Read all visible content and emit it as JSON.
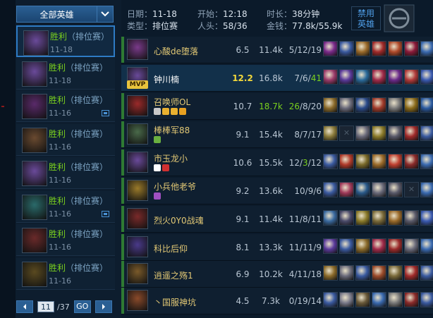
{
  "filter": {
    "label": "全部英雄"
  },
  "games": [
    {
      "result": "胜利",
      "queue": "（排位赛）",
      "date": "11-18",
      "color": "#6a4a9a",
      "flag": false
    },
    {
      "result": "胜利",
      "queue": "（排位赛）",
      "date": "11-18",
      "color": "#6a4a9a",
      "flag": false
    },
    {
      "result": "胜利",
      "queue": "（排位赛）",
      "date": "11-16",
      "color": "#5a2a6a",
      "flag": true
    },
    {
      "result": "胜利",
      "queue": "（排位赛）",
      "date": "11-16",
      "color": "#6a4a30",
      "flag": false
    },
    {
      "result": "胜利",
      "queue": "（排位赛）",
      "date": "11-16",
      "color": "#6a4a9a",
      "flag": false
    },
    {
      "result": "胜利",
      "queue": "（排位赛）",
      "date": "11-16",
      "color": "#2a6a6a",
      "flag": true
    },
    {
      "result": "胜利",
      "queue": "（排位赛）",
      "date": "11-16",
      "color": "#6a2a2a",
      "flag": false
    },
    {
      "result": "胜利",
      "queue": "（排位赛）",
      "date": "11-16",
      "color": "#5a4a20",
      "flag": false
    }
  ],
  "pager": {
    "page": "11",
    "total": "/37",
    "go": "GO"
  },
  "info": {
    "date_k": "日期：",
    "date_v": "11-18",
    "type_k": "类型：",
    "type_v": "排位赛",
    "start_k": "开始：",
    "start_v": "12:18",
    "people_k": "人头：",
    "people_v": "58/36",
    "dur_k": "时长：",
    "dur_v": "38分钟",
    "money_k": "金钱：",
    "money_v": "77.8k/55.9k",
    "ban_l1": "禁用",
    "ban_l2": "英雄"
  },
  "mvp": "MVP",
  "players": [
    {
      "name": "心酸de堕落",
      "kda_ratio": "6.5",
      "gold": "11.4k",
      "stats": "5/12/19",
      "green": "",
      "sel": false,
      "color": "#7a3a8a",
      "items": [
        "#7a2a8a",
        "#3a5aa0",
        "#9a6a2a",
        "#a02a2a",
        "#b04a2a",
        "#8a1a3a",
        "#3a6ab0"
      ]
    },
    {
      "name": "钟川楠",
      "kda_ratio": "12.2",
      "gold": "16.8k",
      "stats_pre": "7/6/",
      "stats_g": "41",
      "sel": true,
      "color": "#6a4a9a",
      "items": [
        "#9a3a6a",
        "#5a3a9a",
        "#2a6a9a",
        "#a02a4a",
        "#6a2a8a",
        "#b03a3a",
        "#3a5ab0"
      ]
    },
    {
      "name": "召唤师OL",
      "kda_ratio": "10.7",
      "gold": "18.7k",
      "gold_hi": true,
      "stats_pre_g": "26",
      "stats_post": "/8/20",
      "sel": false,
      "color": "#9a2a2a",
      "items": [
        "#8a6a2a",
        "#6a6a7a",
        "#2a4a8a",
        "#a03a2a",
        "#7a7a7a",
        "#8a6a1a",
        "#2a5aa0"
      ],
      "badges": [
        "#c8c8c8",
        "#e8b030",
        "#e8b030",
        "#e8a020"
      ]
    },
    {
      "name": "棒棒军88",
      "kda_ratio": "9.1",
      "gold": "15.4k",
      "stats": "8/7/17",
      "sel": false,
      "color": "#4a6a4a",
      "items": [
        "#8a7a3a",
        "empty",
        "#6a6a7a",
        "#8a7a2a",
        "#5a5a6a",
        "#a02a2a",
        "#3a5aa0"
      ],
      "badges": [
        "#6ab040"
      ]
    },
    {
      "name": "市玉龙小",
      "kda_ratio": "10.6",
      "gold": "15.5k",
      "stats_pre": "12/",
      "stats_g": "3",
      "stats_post": "/12",
      "sel": false,
      "color": "#6a4a9a",
      "items": [
        "#3a5aa0",
        "#b03a2a",
        "#7a6a2a",
        "#9a6a2a",
        "#c04030",
        "#8a2a2a",
        "#3a6ab0"
      ],
      "badges": [
        "#ffffff",
        "#d03030"
      ]
    },
    {
      "name": "小兵他老爷",
      "kda_ratio": "9.2",
      "gold": "13.6k",
      "stats": "10/9/6",
      "sel": false,
      "color": "#9a7a2a",
      "items": [
        "#3a5aa0",
        "#a03a5a",
        "#2a5a8a",
        "#6a6a7a",
        "#5a5a6a",
        "empty",
        "#3a6ab0"
      ],
      "badges": [
        "#a050c0"
      ]
    },
    {
      "name": "烈火0Y0战魂",
      "kda_ratio": "9.1",
      "gold": "11.4k",
      "stats": "11/8/11",
      "sel": false,
      "color": "#7a2a2a",
      "items": [
        "#3a6aa0",
        "#4a4a6a",
        "#8a7a2a",
        "#7a6a3a",
        "#9a6a2a",
        "#5a5a6a",
        "#3a5ab0"
      ]
    },
    {
      "name": "科比后仰",
      "kda_ratio": "8.1",
      "gold": "13.3k",
      "stats": "11/11/9",
      "sel": false,
      "color": "#4a3a8a",
      "items": [
        "#5a3a9a",
        "#3a5aa0",
        "#8a6a2a",
        "#a02a4a",
        "#9a2a2a",
        "#6a6a7a",
        "#3a6ab0"
      ]
    },
    {
      "name": "逍遥之殇1",
      "kda_ratio": "6.9",
      "gold": "10.2k",
      "stats": "4/11/18",
      "sel": false,
      "color": "#7a5a2a",
      "items": [
        "#8a6a2a",
        "#6a6a7a",
        "#3a5aa0",
        "#9a4a2a",
        "#7a6a3a",
        "#a02a2a",
        "#3a5aa0"
      ]
    },
    {
      "name": "丶国服神坑",
      "kda_ratio": "4.5",
      "gold": "7.3k",
      "stats": "0/19/14",
      "sel": false,
      "color": "#8a4a2a",
      "items": [
        "#3a5aa0",
        "#7a7a8a",
        "#6a5a3a",
        "#3a6ab0",
        "#7a7a7a",
        "#8a2a2a",
        "#3a5aa0"
      ]
    }
  ]
}
